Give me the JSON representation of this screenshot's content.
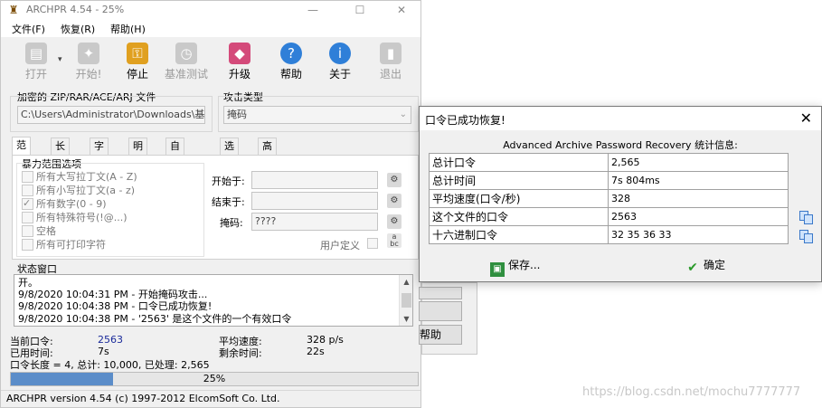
{
  "window": {
    "title": "ARCHPR 4.54 - 25%",
    "icon": "lock-key-icon",
    "controls": {
      "minimize": "—",
      "maximize": "☐",
      "close": "✕"
    }
  },
  "menu": [
    "文件(F)",
    "恢复(R)",
    "帮助(H)"
  ],
  "toolbar": [
    {
      "label": "打开",
      "icon": "open-folder-icon",
      "enabled": false,
      "color": "#c9c9c9"
    },
    {
      "label": "开始!",
      "icon": "start-wrench-icon",
      "enabled": false,
      "color": "#c9c9c9"
    },
    {
      "label": "停止",
      "icon": "stop-keys-icon",
      "enabled": true,
      "color": "#e0a020"
    },
    {
      "label": "基准测试",
      "icon": "stopwatch-icon",
      "enabled": false,
      "color": "#c9c9c9"
    },
    {
      "label": "升级",
      "icon": "upgrade-icon",
      "enabled": true,
      "color": "#d44a7a"
    },
    {
      "label": "帮助",
      "icon": "help-icon",
      "enabled": true,
      "color": "#2f7fd8"
    },
    {
      "label": "关于",
      "icon": "info-icon",
      "enabled": true,
      "color": "#2f7fd8"
    },
    {
      "label": "退出",
      "icon": "exit-door-icon",
      "enabled": false,
      "color": "#c9c9c9"
    }
  ],
  "archive": {
    "label": "加密的 ZIP/RAR/ACE/ARJ 文件",
    "path": "C:\\Users\\Administrator\\Downloads\\基础破"
  },
  "attack": {
    "label": "攻击类型",
    "selected": "掩码"
  },
  "tabs": [
    "范围",
    "长度",
    "字典",
    "明文",
    "自动保存",
    "选项",
    "高级"
  ],
  "range": {
    "group_label": "暴力范围选项",
    "options": [
      {
        "label": "所有大写拉丁文(A - Z)",
        "checked": false
      },
      {
        "label": "所有小写拉丁文(a - z)",
        "checked": false
      },
      {
        "label": "所有数字(0 - 9)",
        "checked": true
      },
      {
        "label": "所有特殊符号(!@...)",
        "checked": false
      },
      {
        "label": "空格",
        "checked": false
      },
      {
        "label": "所有可打印字符",
        "checked": false
      }
    ],
    "start_label": "开始于:",
    "end_label": "结束于:",
    "mask_label": "掩码:",
    "mask_value": "????",
    "user_defined_label": "用户定义"
  },
  "log": {
    "label": "状态窗口",
    "lines": [
      "开。",
      "9/8/2020 10:04:31 PM - 开始掩码攻击...",
      "9/8/2020 10:04:38 PM - 口令已成功恢复!",
      "9/8/2020 10:04:38 PM - '2563' 是这个文件的一个有效口令"
    ]
  },
  "stats": {
    "current_label": "当前口令:",
    "current_value": "2563",
    "elapsed_label": "已用时间:",
    "elapsed_value": "7s",
    "avg_label": "平均速度:",
    "avg_value": "328 p/s",
    "remaining_label": "剩余时间:",
    "remaining_value": "22s",
    "summary": "口令长度 = 4, 总计: 10,000, 已处理: 2,565"
  },
  "progress": {
    "percent": 25,
    "label": "25%"
  },
  "statusbar": "ARCHPR version 4.54 (c) 1997-2012 ElcomSoft Co. Ltd.",
  "background_buttons": [
    "帮助"
  ],
  "dialog": {
    "title": "口令已成功恢复!",
    "heading": "Advanced Archive Password Recovery 统计信息:",
    "rows": [
      {
        "key": "总计口令",
        "value": "2,565",
        "copyable": false
      },
      {
        "key": "总计时间",
        "value": "7s 804ms",
        "copyable": false
      },
      {
        "key": "平均速度(口令/秒)",
        "value": "328",
        "copyable": false
      },
      {
        "key": "这个文件的口令",
        "value": "2563",
        "copyable": true
      },
      {
        "key": "十六进制口令",
        "value": "32 35 36 33",
        "copyable": true
      }
    ],
    "save_label": "保存...",
    "ok_label": "确定"
  },
  "watermark": "https://blog.csdn.net/mochu7777777"
}
